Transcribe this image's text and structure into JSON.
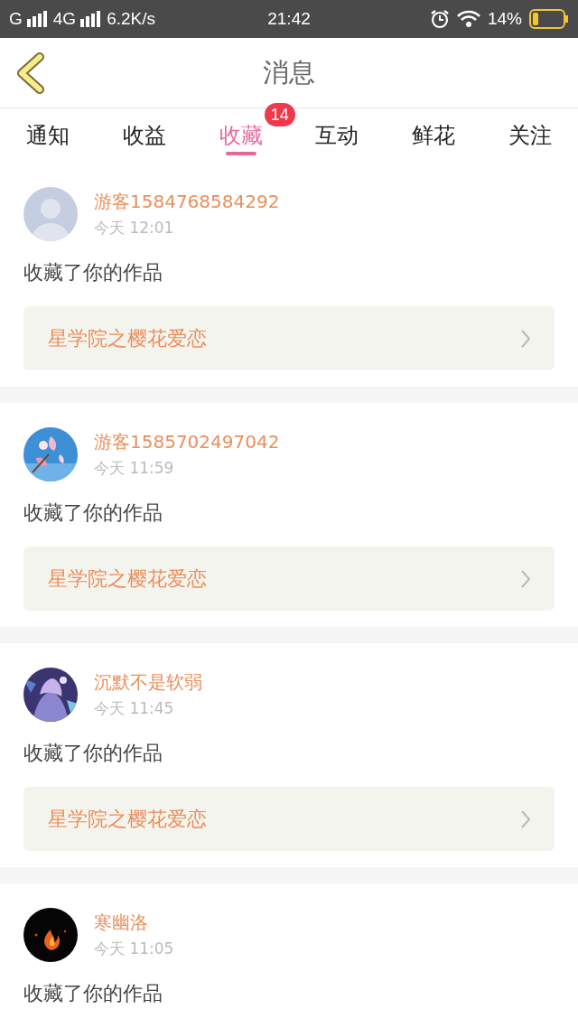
{
  "status_bar": {
    "carrier_1": "G",
    "carrier_2": "4G",
    "speed": "6.2K/s",
    "time": "21:42",
    "battery": "14%"
  },
  "header": {
    "title": "消息"
  },
  "tabs": [
    {
      "label": "通知",
      "selected": false
    },
    {
      "label": "收益",
      "selected": false
    },
    {
      "label": "收藏",
      "selected": true,
      "badge": "14"
    },
    {
      "label": "互动",
      "selected": false
    },
    {
      "label": "鲜花",
      "selected": false
    },
    {
      "label": "关注",
      "selected": false
    }
  ],
  "messages": [
    {
      "avatar": {
        "kind": "default"
      },
      "name": "游客1584768584292",
      "time": "今天 12:01",
      "action": "收藏了你的作品",
      "work": {
        "title": "星学院之樱花爱恋"
      }
    },
    {
      "name": "游客1585702497042",
      "time": "今天 11:59",
      "action": "收藏了你的作品",
      "work": {
        "title": "星学院之樱花爱恋"
      }
    },
    {
      "name": "沉默不是软弱",
      "time": "今天 11:45",
      "action": "收藏了你的作品",
      "work": {
        "title": "星学院之樱花爱恋"
      }
    },
    {
      "name": "寒幽洛",
      "time": "今天 11:05",
      "action": "收藏了你的作品"
    }
  ]
}
